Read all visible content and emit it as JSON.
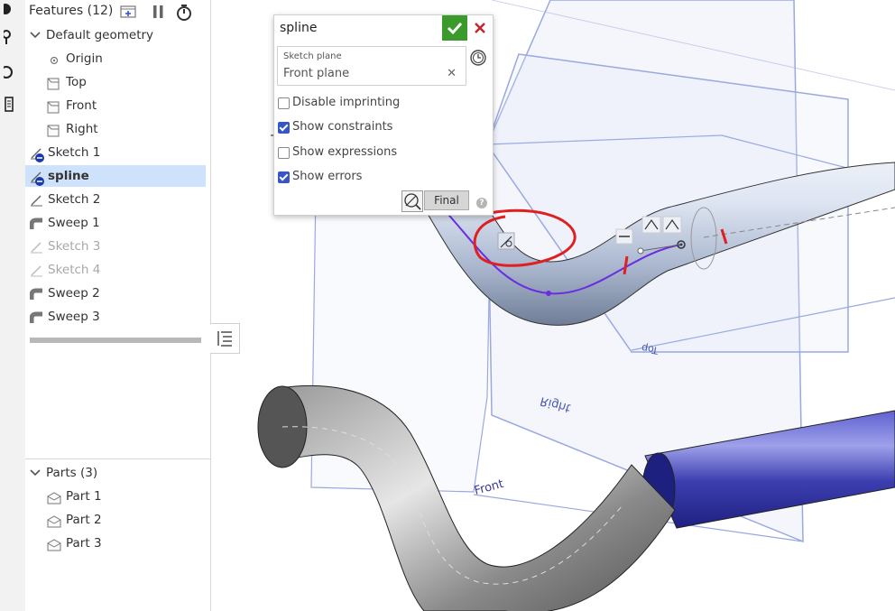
{
  "feature_panel": {
    "title": "Features (12)",
    "items": [
      {
        "label": "Default geometry",
        "kind": "folder"
      },
      {
        "label": "Origin",
        "kind": "origin"
      },
      {
        "label": "Top",
        "kind": "plane"
      },
      {
        "label": "Front",
        "kind": "plane"
      },
      {
        "label": "Right",
        "kind": "plane"
      },
      {
        "label": "Sketch 1",
        "kind": "sketch"
      },
      {
        "label": "spline",
        "kind": "sketch",
        "state": "selected"
      },
      {
        "label": "Sketch 2",
        "kind": "sketch"
      },
      {
        "label": "Sweep 1",
        "kind": "sweep"
      },
      {
        "label": "Sketch 3",
        "kind": "sketch",
        "state": "hidden"
      },
      {
        "label": "Sketch 4",
        "kind": "sketch",
        "state": "hidden"
      },
      {
        "label": "Sweep 2",
        "kind": "sweep"
      },
      {
        "label": "Sweep 3",
        "kind": "sweep"
      }
    ]
  },
  "parts_panel": {
    "title": "Parts (3)",
    "items": [
      "Part 1",
      "Part 2",
      "Part 3"
    ]
  },
  "dialog": {
    "title": "spline",
    "sketch_plane_caption": "Sketch plane",
    "sketch_plane_value": "Front plane",
    "options": [
      {
        "label": "Disable imprinting",
        "checked": false
      },
      {
        "label": "Show constraints",
        "checked": true
      },
      {
        "label": "Show expressions",
        "checked": false
      },
      {
        "label": "Show errors",
        "checked": true
      }
    ],
    "final_label": "Final",
    "help_glyph": "?"
  },
  "viewport": {
    "plane_labels": [
      "Top",
      "Right",
      "Front"
    ]
  },
  "colors": {
    "accent": "#3555c8",
    "ok_green": "#3a9a2a",
    "cancel_red": "#c0282d",
    "selection": "#cfe2fb",
    "spline_purple": "#6a2ee0",
    "markup_red": "#e02020",
    "plane_blue": "#9aa8e0",
    "sweep3_blue": "#3d3fb0",
    "sweep2_gray": "#8a8a8a"
  },
  "icons": {
    "plane": "plane-icon",
    "sketch": "sketch-icon",
    "sweep": "sweep-icon",
    "part": "part-icon",
    "origin": "origin-icon"
  }
}
